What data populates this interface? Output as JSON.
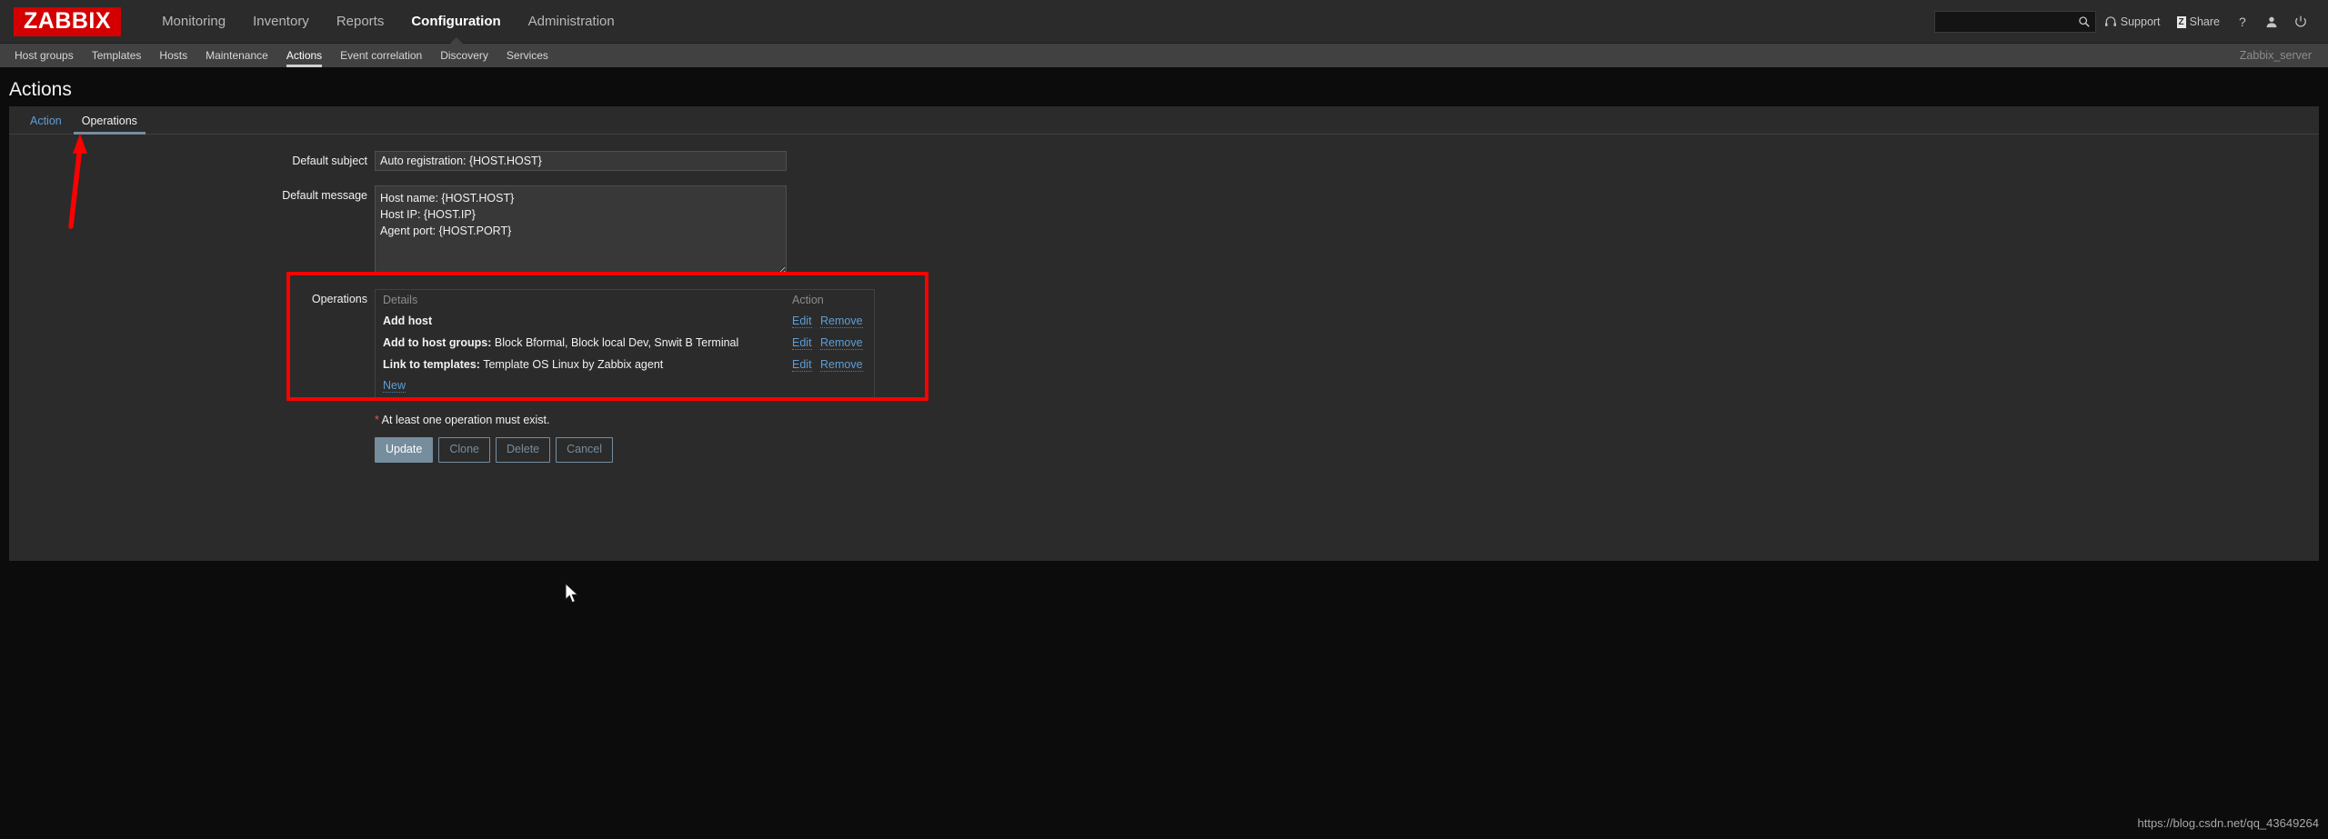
{
  "brand": {
    "logo_text": "ZABBIX",
    "logo_color": "#d40000"
  },
  "header": {
    "nav": [
      {
        "label": "Monitoring",
        "selected": false
      },
      {
        "label": "Inventory",
        "selected": false
      },
      {
        "label": "Reports",
        "selected": false
      },
      {
        "label": "Configuration",
        "selected": true
      },
      {
        "label": "Administration",
        "selected": false
      }
    ],
    "search": {
      "value": "",
      "placeholder": "",
      "icon": "search-icon"
    },
    "support_label": "Support",
    "support_icon": "headset-icon",
    "share_label": "Share",
    "share_badge": "Z",
    "help_icon": "question-mark-icon",
    "user_icon": "user-icon",
    "signout_icon": "power-icon"
  },
  "subnav": {
    "items": [
      {
        "label": "Host groups",
        "selected": false
      },
      {
        "label": "Templates",
        "selected": false
      },
      {
        "label": "Hosts",
        "selected": false
      },
      {
        "label": "Maintenance",
        "selected": false
      },
      {
        "label": "Actions",
        "selected": true
      },
      {
        "label": "Event correlation",
        "selected": false
      },
      {
        "label": "Discovery",
        "selected": false
      },
      {
        "label": "Services",
        "selected": false
      }
    ],
    "server": "Zabbix_server"
  },
  "page": {
    "title": "Actions"
  },
  "tabs": [
    {
      "label": "Action",
      "active": false
    },
    {
      "label": "Operations",
      "active": true
    }
  ],
  "form": {
    "default_subject": {
      "label": "Default subject",
      "value": "Auto registration: {HOST.HOST}",
      "placeholder": ""
    },
    "default_message": {
      "label": "Default message",
      "value": "Host name: {HOST.HOST}\nHost IP: {HOST.IP}\nAgent port: {HOST.PORT}",
      "placeholder": ""
    },
    "operations": {
      "label": "Operations",
      "columns": {
        "details": "Details",
        "action": "Action"
      },
      "rows": [
        {
          "details_prefix": "Add host",
          "details_value": "",
          "edit_label": "Edit",
          "remove_label": "Remove"
        },
        {
          "details_prefix": "Add to host groups:",
          "details_value": "Block Bformal, Block local Dev, Snwit B Terminal",
          "edit_label": "Edit",
          "remove_label": "Remove"
        },
        {
          "details_prefix": "Link to templates:",
          "details_value": "Template OS Linux by Zabbix agent",
          "edit_label": "Edit",
          "remove_label": "Remove"
        }
      ],
      "new_label": "New"
    },
    "error": {
      "star": "*",
      "text": "At least one operation must exist."
    },
    "buttons": [
      {
        "label": "Update",
        "primary": true
      },
      {
        "label": "Clone",
        "primary": false
      },
      {
        "label": "Delete",
        "primary": false
      },
      {
        "label": "Cancel",
        "primary": false
      }
    ]
  },
  "annotations": {
    "rect_color": "#fd0000",
    "arrow_color": "#fd0000"
  },
  "watermark": "https://blog.csdn.net/qq_43649264"
}
